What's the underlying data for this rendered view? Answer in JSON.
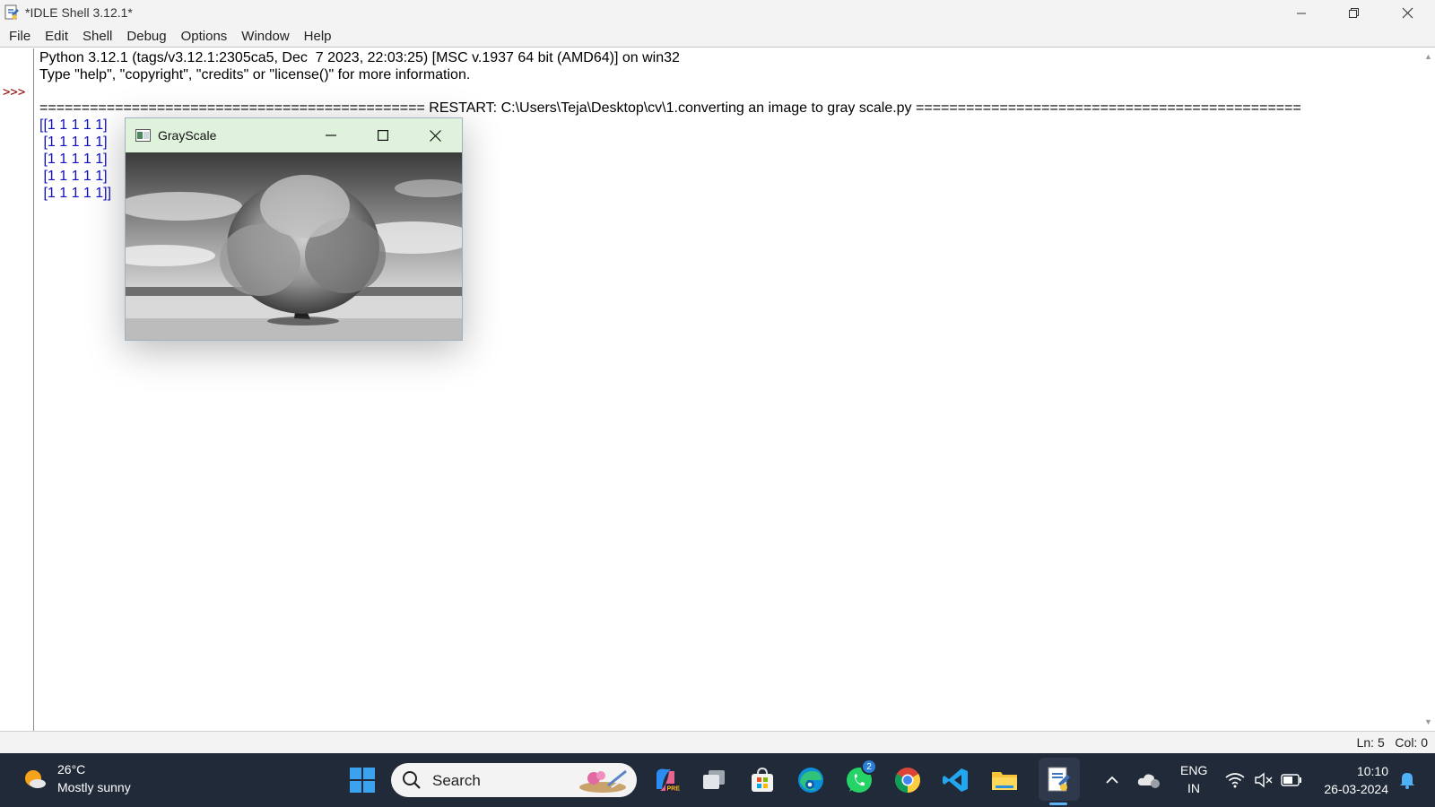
{
  "window": {
    "title": "*IDLE Shell 3.12.1*",
    "minimize": "—",
    "maximize": "❐",
    "close": "✕"
  },
  "menu": [
    "File",
    "Edit",
    "Shell",
    "Debug",
    "Options",
    "Window",
    "Help"
  ],
  "shell": {
    "prompt": ">>>",
    "banner_line1": "Python 3.12.1 (tags/v3.12.1:2305ca5, Dec  7 2023, 22:03:25) [MSC v.1937 64 bit (AMD64)] on win32",
    "banner_line2": "Type \"help\", \"copyright\", \"credits\" or \"license()\" for more information.",
    "restart_line": "============================================== RESTART: C:\\Users\\Teja\\Desktop\\cv\\1.converting an image to gray scale.py ==============================================",
    "output": [
      "[[1 1 1 1 1]",
      " [1 1 1 1 1]",
      " [1 1 1 1 1]",
      " [1 1 1 1 1]",
      " [1 1 1 1 1]]"
    ]
  },
  "status": {
    "position": "Ln: 5   Col: 0"
  },
  "popup": {
    "title": "GrayScale",
    "image": "grayscale-tree-photo"
  },
  "taskbar": {
    "weather_temp": "26°C",
    "weather_desc": "Mostly sunny",
    "search_label": "Search",
    "whatsapp_badge": "2",
    "apps": [
      "start-icon",
      "search",
      "copilot-icon",
      "task-view-icon",
      "store-icon",
      "edge-icon",
      "whatsapp-icon",
      "chrome-icon",
      "vscode-icon",
      "file-explorer-icon",
      "idle-icon"
    ],
    "lang_top": "ENG",
    "lang_bottom": "IN",
    "time": "10:10",
    "date": "26-03-2024"
  },
  "colors": {
    "output_blue": "#1010c0",
    "prompt_red": "#8b0000",
    "taskbar_bg": "#202a38",
    "popup_titlebar": "#dff3dc"
  }
}
